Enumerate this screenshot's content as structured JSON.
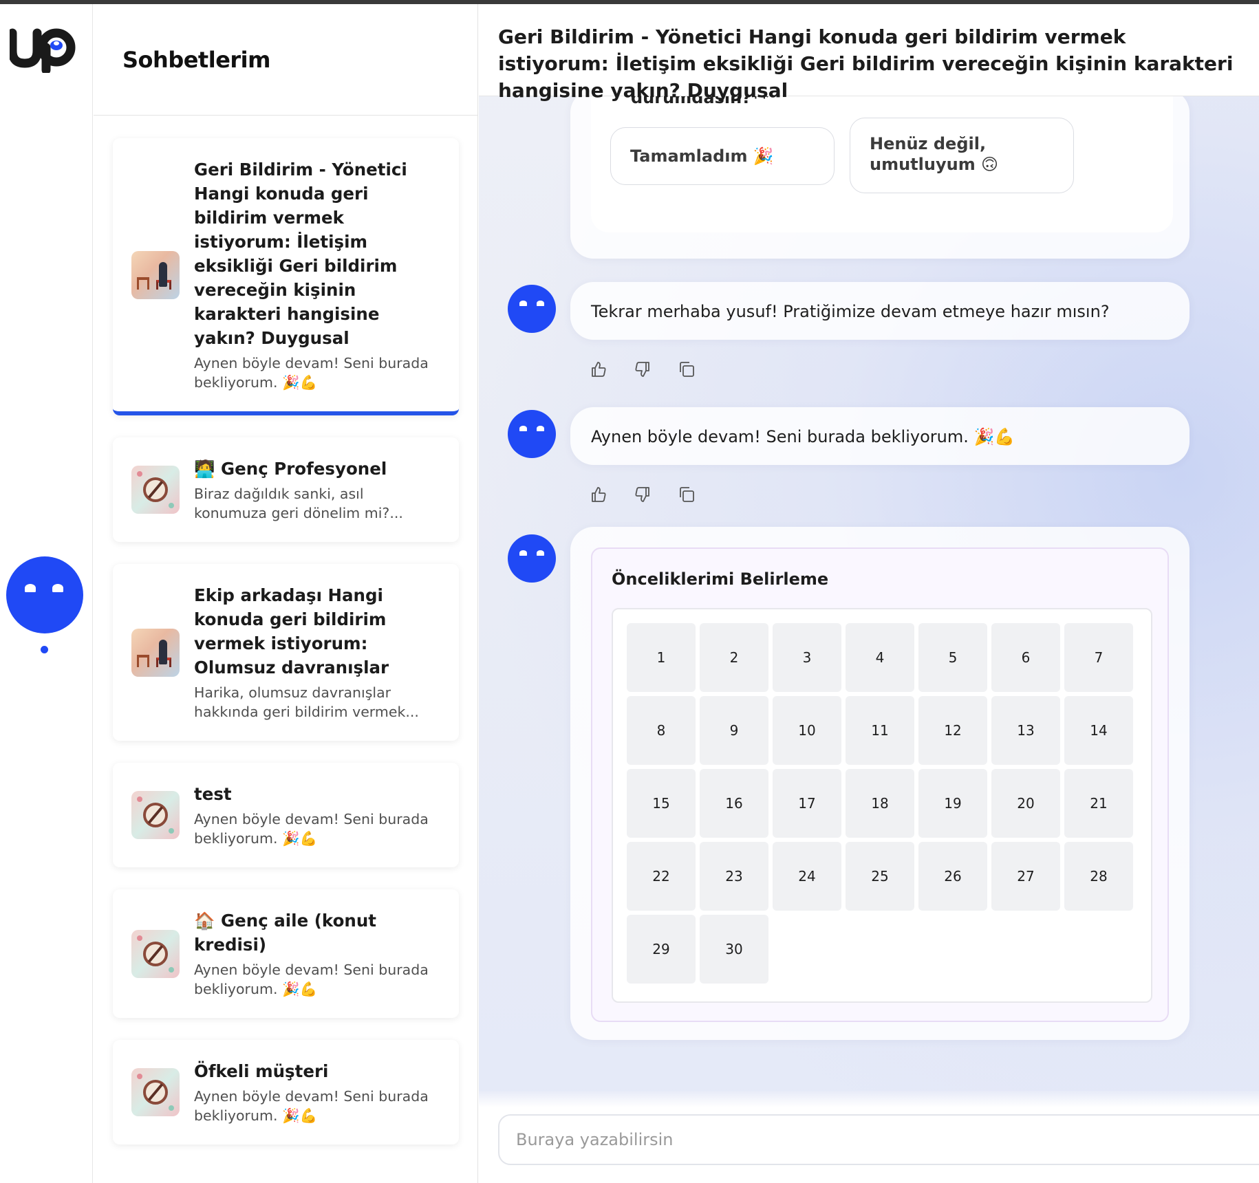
{
  "app": {
    "logo_text": "up"
  },
  "sidebar": {
    "title": "Sohbetlerim"
  },
  "conversations": [
    {
      "title": "Geri Bildirim - Yönetici Hangi konuda geri bildirim vermek istiyorum: İletişim eksikliği Geri bildirim vereceğin kişinin karakteri hangisine yakın? Duygusal",
      "preview": "Aynen böyle devam! Seni burada bekliyorum. 🎉💪",
      "thumb": "person",
      "active": true
    },
    {
      "title": "🧑‍💻 Genç Profesyonel",
      "preview": "Biraz dağıldık sanki, asıl konumuza geri dönelim mi?...",
      "thumb": "compass",
      "active": false
    },
    {
      "title": "Ekip arkadaşı Hangi konuda geri bildirim vermek istiyorum: Olumsuz davranışlar",
      "preview": "Harika, olumsuz davranışlar hakkında geri bildirim vermek...",
      "thumb": "person",
      "active": false
    },
    {
      "title": "test",
      "preview": "Aynen böyle devam! Seni burada bekliyorum. 🎉💪",
      "thumb": "compass",
      "active": false
    },
    {
      "title": "🏠 Genç aile (konut kredisi)",
      "preview": "Aynen böyle devam! Seni burada bekliyorum. 🎉💪",
      "thumb": "compass",
      "active": false
    },
    {
      "title": "Öfkeli müşteri",
      "preview": "Aynen böyle devam! Seni burada bekliyorum. 🎉💪",
      "thumb": "compass",
      "active": false
    }
  ],
  "chat": {
    "title": "Geri Bildirim - Yönetici Hangi konuda geri bildirim vermek istiyorum: İletişim eksikliği Geri bildirim vereceğin kişinin karakteri hangisine yakın? Duygusal",
    "quiz_question_tail": "durumdasın?**",
    "options": [
      "Tamamladım 🎉",
      "Henüz değil, umutluyum 🙃"
    ],
    "messages": [
      "Tekrar merhaba yusuf! Pratiğimize devam etmeye hazır mısın?",
      "Aynen böyle devam! Seni burada bekliyorum. 🎉💪"
    ],
    "calendar": {
      "title": "Önceliklerimi Belirleme",
      "days": [
        "1",
        "2",
        "3",
        "4",
        "5",
        "6",
        "7",
        "8",
        "9",
        "10",
        "11",
        "12",
        "13",
        "14",
        "15",
        "16",
        "17",
        "18",
        "19",
        "20",
        "21",
        "22",
        "23",
        "24",
        "25",
        "26",
        "27",
        "28",
        "29",
        "30"
      ]
    },
    "composer_placeholder": "Buraya yazabilirsin"
  },
  "colors": {
    "brand": "#2049f5",
    "active_underline": "#2454e8"
  },
  "icons": {
    "like": "thumbs-up-icon",
    "dislike": "thumbs-down-icon",
    "copy": "copy-icon"
  }
}
